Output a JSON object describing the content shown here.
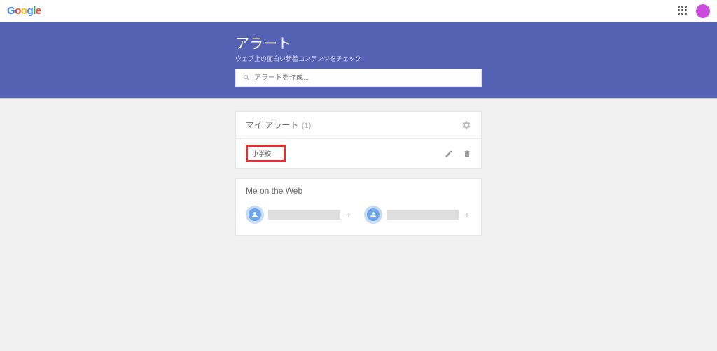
{
  "header": {
    "logo_text": "Google"
  },
  "banner": {
    "title": "アラート",
    "subtitle": "ウェブ上の面白い新着コンテンツをチェック",
    "search_placeholder": "アラートを作成..."
  },
  "my_alerts": {
    "title": "マイ アラート",
    "count": "(1)",
    "items": [
      {
        "name": "小学校"
      }
    ]
  },
  "me_on_web": {
    "title": "Me on the Web",
    "items": [
      {
        "plus": "+"
      },
      {
        "plus": "+"
      }
    ]
  },
  "colors": {
    "banner_bg": "#5561b3",
    "avatar": "#c94cdb",
    "highlight_border": "#e03131"
  }
}
